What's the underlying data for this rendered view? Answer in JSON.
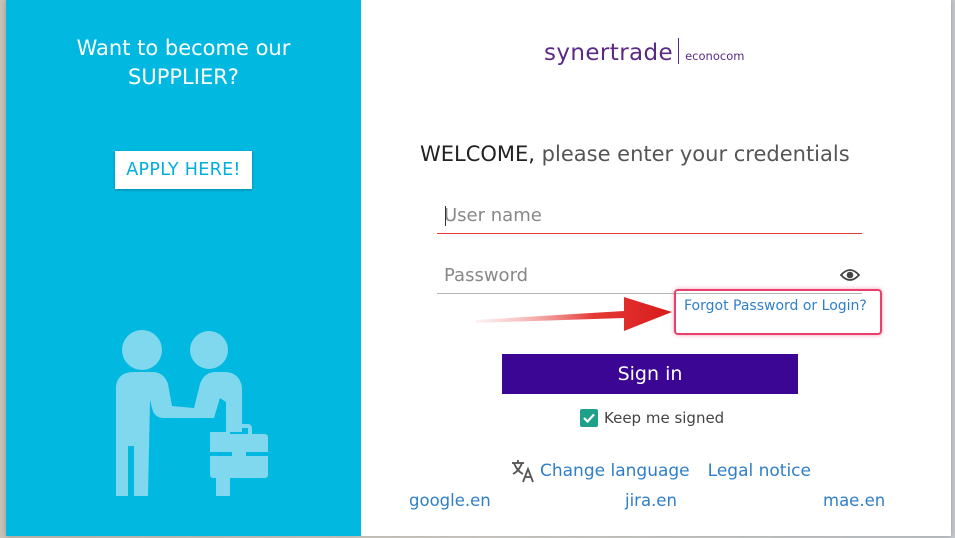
{
  "promo": {
    "title_line1": "Want to become our",
    "title_line2": "SUPPLIER?",
    "apply_label": "APPLY HERE!",
    "illustration_icon": "handshake-icon"
  },
  "brand": {
    "name": "synertrade",
    "sub": "econocom",
    "color": "#5b2a85"
  },
  "login": {
    "welcome_bold": "WELCOME,",
    "welcome_rest": " please enter your credentials",
    "username_placeholder": "User name",
    "username_value": "",
    "password_placeholder": "Password",
    "password_value": "",
    "forgot_label": "Forgot Password or Login?",
    "signin_label": "Sign in",
    "keep_signed_label": "Keep me signed",
    "keep_signed_checked": true
  },
  "footer": {
    "change_language_label": "Change language",
    "legal_notice_label": "Legal notice",
    "domains": [
      "google.en",
      "jira.en",
      "mae.en"
    ]
  },
  "colors": {
    "left_panel": "#00b8e0",
    "signin_button": "#3a0693",
    "link": "#2f7fc8",
    "annotation": "#e8406b",
    "checkbox": "#1fa08a"
  }
}
